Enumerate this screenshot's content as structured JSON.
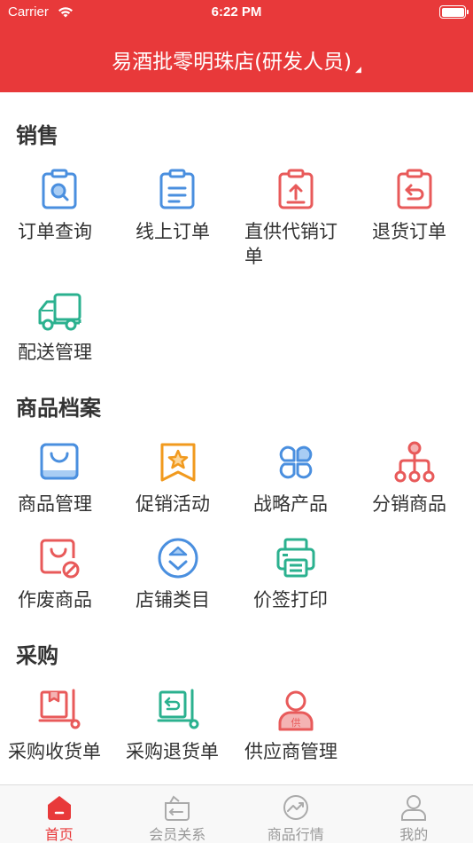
{
  "status_bar": {
    "carrier": "Carrier",
    "time": "6:22 PM"
  },
  "header": {
    "title": "易酒批零明珠店(研发人员)"
  },
  "sections": [
    {
      "title": "销售",
      "items": [
        {
          "label": "订单查询",
          "icon": "clipboard-search-icon"
        },
        {
          "label": "线上订单",
          "icon": "clipboard-list-icon"
        },
        {
          "label": "直供代销订单",
          "icon": "clipboard-upload-icon"
        },
        {
          "label": "退货订单",
          "icon": "clipboard-return-icon"
        },
        {
          "label": "配送管理",
          "icon": "delivery-truck-icon"
        }
      ]
    },
    {
      "title": "商品档案",
      "items": [
        {
          "label": "商品管理",
          "icon": "shopping-bag-icon"
        },
        {
          "label": "促销活动",
          "icon": "star-bookmark-icon"
        },
        {
          "label": "战略产品",
          "icon": "four-petal-icon"
        },
        {
          "label": "分销商品",
          "icon": "distribution-tree-icon"
        },
        {
          "label": "作废商品",
          "icon": "bag-forbidden-icon"
        },
        {
          "label": "店铺类目",
          "icon": "sort-circle-icon"
        },
        {
          "label": "价签打印",
          "icon": "printer-icon"
        }
      ]
    },
    {
      "title": "采购",
      "items": [
        {
          "label": "采购收货单",
          "icon": "box-cart-icon"
        },
        {
          "label": "采购退货单",
          "icon": "return-cart-icon"
        },
        {
          "label": "供应商管理",
          "icon": "supplier-person-icon",
          "badge": "供"
        }
      ]
    }
  ],
  "tabs": [
    {
      "label": "首页",
      "icon": "home-icon",
      "active": true
    },
    {
      "label": "会员关系",
      "icon": "member-icon",
      "active": false
    },
    {
      "label": "商品行情",
      "icon": "market-trend-icon",
      "active": false
    },
    {
      "label": "我的",
      "icon": "profile-icon",
      "active": false
    }
  ],
  "colors": {
    "brand": "#e8393a",
    "blue": "#4a8fdf",
    "orange": "#f19a1e",
    "green": "#2bb18f",
    "red": "#e85a5a"
  }
}
